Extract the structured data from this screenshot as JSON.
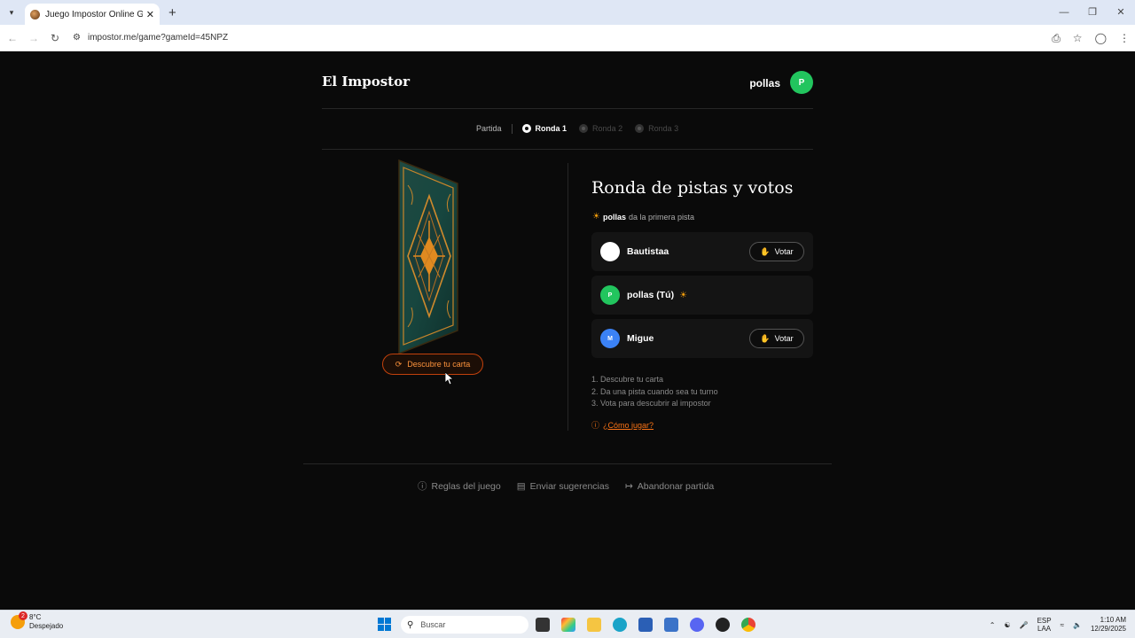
{
  "browser": {
    "tab_title": "Juego Impostor Online Gratis -",
    "url": "impostor.me/game?gameId=45NPZ"
  },
  "header": {
    "brand": "El Impostor",
    "user_name": "pollas",
    "user_initial": "P"
  },
  "steps": {
    "partida": "Partida",
    "rounds": [
      {
        "label": "Ronda 1",
        "active": true
      },
      {
        "label": "Ronda 2",
        "active": false
      },
      {
        "label": "Ronda 3",
        "active": false
      }
    ]
  },
  "card": {
    "reveal_label": "Descubre tu carta"
  },
  "round": {
    "title": "Ronda de pistas y votos",
    "first_clue_name": "pollas",
    "first_clue_text": "da la primera pista"
  },
  "players": [
    {
      "name": "Bautistaa",
      "initial": "",
      "color": "#ffffff",
      "vote_label": "Votar"
    },
    {
      "name": "pollas (Tú)",
      "initial": "P",
      "color": "#22c55e",
      "vote_label": ""
    },
    {
      "name": "Migue",
      "initial": "M",
      "color": "#3b82f6",
      "vote_label": "Votar"
    }
  ],
  "instructions": [
    "1. Descubre tu carta",
    "2. Da una pista cuando sea tu turno",
    "3. Vota para descubrir al impostor"
  ],
  "howto_label": "¿Cómo jugar?",
  "footer": {
    "rules": "Reglas del juego",
    "suggestions": "Enviar sugerencias",
    "leave": "Abandonar partida"
  },
  "taskbar": {
    "weather_temp": "8°C",
    "weather_desc": "Despejado",
    "weather_badge": "2",
    "search_placeholder": "Buscar",
    "lang_top": "ESP",
    "lang_bottom": "LAA",
    "time": "1:10 AM",
    "date": "12/29/2025"
  },
  "colors": {
    "accent": "#f97316",
    "user_avatar": "#22c55e",
    "background": "#0a0a0a"
  }
}
